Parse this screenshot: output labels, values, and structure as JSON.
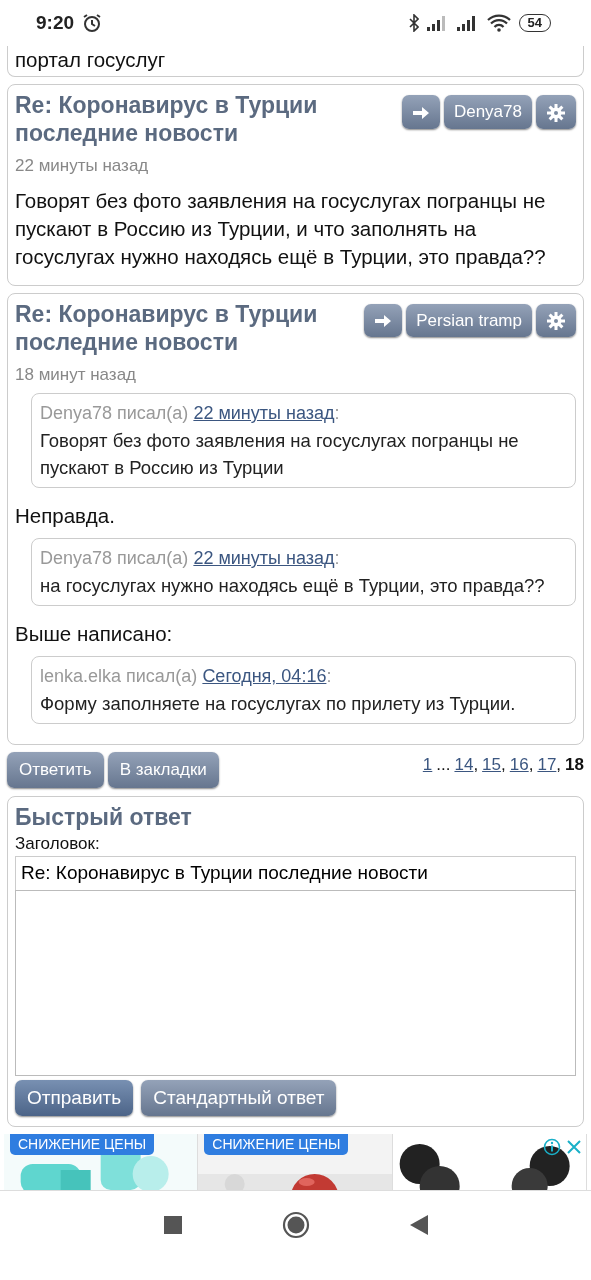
{
  "status_bar": {
    "time": "9:20",
    "battery": "54"
  },
  "previous_post_tail": "портал госуслуг",
  "posts": [
    {
      "title": "Re: Коронавирус в Турции последние новости",
      "author": "Denya78",
      "time": "22 минуты назад",
      "content": [
        {
          "kind": "text",
          "text": "Говорят без фото заявления на госуслугах погранцы не пускают в Россию из Турции, и что заполнять на госуслугах нужно находясь ещё в Турции, это правда??"
        }
      ]
    },
    {
      "title": "Re: Коронавирус в Турции последние новости",
      "author": "Persian tramp",
      "time": "18 минут назад",
      "content": [
        {
          "kind": "quote",
          "by": "Denya78 писал(а)",
          "link": "22 минуты назад",
          "suffix": ":",
          "text": "Говорят без фото заявления на госуслугах погранцы не пускают в Россию из Турции"
        },
        {
          "kind": "text",
          "text": "Неправда."
        },
        {
          "kind": "quote",
          "by": "Denya78 писал(а)",
          "link": "22 минуты назад",
          "suffix": ":",
          "text": "на госуслугах нужно находясь ещё в Турции, это правда??"
        },
        {
          "kind": "text",
          "text": "Выше написано:"
        },
        {
          "kind": "quote",
          "by": "lenka.elka писал(а)",
          "link": "Сегодня, 04:16",
          "suffix": ":",
          "text": "Форму заполняете на госуслугах по прилету из Турции."
        }
      ]
    }
  ],
  "actions": [
    "Ответить",
    "В закладки"
  ],
  "pagination": [
    {
      "kind": "page",
      "label": "1",
      "selected": false
    },
    {
      "kind": "gap",
      "label": "..."
    },
    {
      "kind": "page",
      "label": "14",
      "selected": false
    },
    {
      "kind": "sep",
      "label": ","
    },
    {
      "kind": "page",
      "label": "15",
      "selected": false
    },
    {
      "kind": "sep",
      "label": ","
    },
    {
      "kind": "page",
      "label": "16",
      "selected": false
    },
    {
      "kind": "sep",
      "label": ","
    },
    {
      "kind": "page",
      "label": "17",
      "selected": false
    },
    {
      "kind": "sep",
      "label": ","
    },
    {
      "kind": "page",
      "label": "18",
      "selected": true
    }
  ],
  "quick_reply": {
    "title": "Быстрый ответ",
    "subject_label": "Заголовок:",
    "subject_value": "Re: Коронавирус в Турции последние новости",
    "buttons": [
      {
        "label": "Отправить",
        "kind": "primary"
      },
      {
        "label": "Стандартный ответ",
        "kind": "secondary"
      }
    ]
  },
  "ads": [
    {
      "kind": "picture",
      "badge": "СНИЖЕНИЕ ЦЕНЫ"
    },
    {
      "kind": "picture",
      "badge": "СНИЖЕНИЕ ЦЕНЫ"
    },
    {
      "kind": "picture"
    }
  ]
}
